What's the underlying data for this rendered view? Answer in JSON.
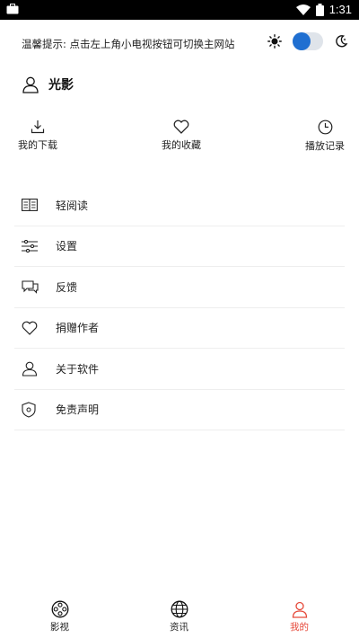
{
  "status_bar": {
    "time": "1:31",
    "left_icon": "briefcase-icon",
    "wifi_icon": "wifi-icon",
    "battery_icon": "battery-icon"
  },
  "header": {
    "notice": "温馨提示: 点击左上角小电视按钮可切换主网站",
    "theme_toggle_on": true
  },
  "user": {
    "name": "光影"
  },
  "quick_actions": [
    {
      "label": "我的下载",
      "icon": "download-icon"
    },
    {
      "label": "我的收藏",
      "icon": "heart-icon"
    },
    {
      "label": "播放记录",
      "icon": "clock-icon"
    }
  ],
  "menu": [
    {
      "label": "轻阅读",
      "icon": "book-icon"
    },
    {
      "label": "设置",
      "icon": "sliders-icon"
    },
    {
      "label": "反馈",
      "icon": "feedback-icon"
    },
    {
      "label": "捐赠作者",
      "icon": "heart-icon"
    },
    {
      "label": "关于软件",
      "icon": "user-icon"
    },
    {
      "label": "免责声明",
      "icon": "shield-icon"
    }
  ],
  "tab_bar": {
    "tabs": [
      {
        "label": "影视",
        "icon": "film-reel-icon"
      },
      {
        "label": "资讯",
        "icon": "globe-icon"
      },
      {
        "label": "我的",
        "icon": "profile-icon",
        "active": true
      }
    ]
  },
  "colors": {
    "accent": "#1f6fd1",
    "active_tab": "#e64a3b"
  }
}
